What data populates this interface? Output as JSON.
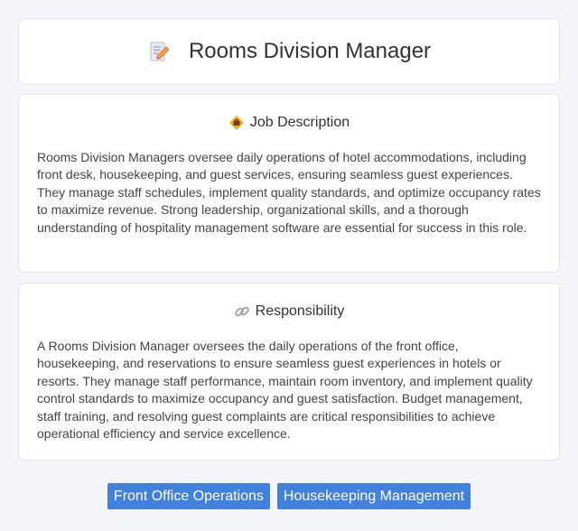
{
  "header": {
    "title": "Rooms Division Manager",
    "icon": "memo-pencil-icon"
  },
  "description": {
    "heading": "Job Description",
    "icon": "diamond-briefcase-icon",
    "body": "Rooms Division Managers oversee daily operations of hotel accommodations, including front desk, housekeeping, and guest services, ensuring seamless guest experiences. They manage staff schedules, implement quality standards, and optimize occupancy rates to maximize revenue. Strong leadership, organizational skills, and a thorough understanding of hospitality management software are essential for success in this role."
  },
  "responsibility": {
    "heading": "Responsibility",
    "icon": "link-icon",
    "body": "A Rooms Division Manager oversees the daily operations of the front office, housekeeping, and reservations to ensure seamless guest experiences in hotels or resorts. They manage staff performance, maintain room inventory, and implement quality control standards to maximize occupancy and guest satisfaction. Budget management, staff training, and resolving guest complaints are critical responsibilities to achieve operational efficiency and service excellence."
  },
  "tags": [
    "Front Office Operations",
    "Housekeeping Management"
  ],
  "colors": {
    "background": "#f3f5fa",
    "card": "#ffffff",
    "tag": "#4180dc",
    "tag_text": "#ffffff"
  }
}
